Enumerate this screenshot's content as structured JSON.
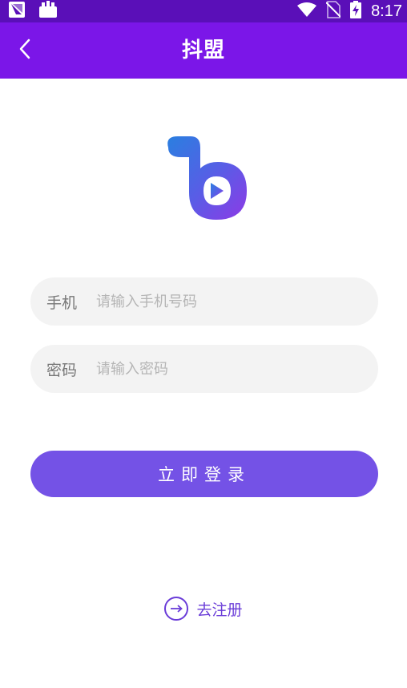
{
  "status_bar": {
    "time": "8:17",
    "icons": [
      "app-notification-icon",
      "shopping-bag-icon",
      "wifi-icon",
      "no-sim-icon",
      "battery-charging-icon"
    ]
  },
  "app_bar": {
    "title": "抖盟",
    "back_icon": "back-chevron-icon"
  },
  "form": {
    "phone": {
      "label": "手机",
      "placeholder": "请输入手机号码",
      "value": ""
    },
    "password": {
      "label": "密码",
      "placeholder": "请输入密码",
      "value": ""
    },
    "login_label": "立即登录"
  },
  "register": {
    "label": "去注册",
    "icon": "arrow-right-circle-icon"
  },
  "colors": {
    "status_bar": "#5a0fb8",
    "app_bar": "#7b16e8",
    "button": "#7452e6",
    "field_bg": "#f3f3f3",
    "link": "#6a3cd8"
  }
}
